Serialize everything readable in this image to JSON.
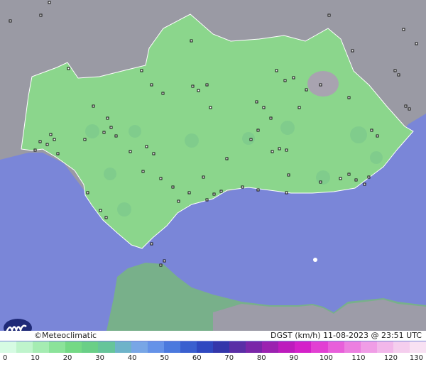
{
  "brand": {
    "name": "Meteoclimatic",
    "symbol": "©"
  },
  "readout": {
    "variable": "DGST",
    "unit": "(km/h)",
    "datetime": "11-08-2023 @ 23:51 UTC"
  },
  "legend": {
    "ticks": [
      "0",
      "10",
      "20",
      "30",
      "40",
      "50",
      "60",
      "70",
      "80",
      "90",
      "100",
      "110",
      "120",
      "130"
    ],
    "colors": [
      "#d6fbe3",
      "#bff4cc",
      "#a5ecb2",
      "#8be39a",
      "#74d985",
      "#6acf87",
      "#66c59a",
      "#6eb3c9",
      "#78a6e6",
      "#6592e8",
      "#4b79de",
      "#3a5fcf",
      "#2f48c0",
      "#3436aa",
      "#5a2ea6",
      "#7a26a8",
      "#9b22b0",
      "#bd1cbd",
      "#d421c9",
      "#e23fd3",
      "#e85fda",
      "#ec7fe0",
      "#f09de6",
      "#f2b7ea",
      "#f5ceee",
      "#f8e1f3"
    ]
  },
  "colors": {
    "sea": "#7a86d8",
    "land_andalucia": "#8ed68c",
    "land_other": "#9c9ca6",
    "africa": "#7fb58a",
    "border": "#ffffff"
  }
}
